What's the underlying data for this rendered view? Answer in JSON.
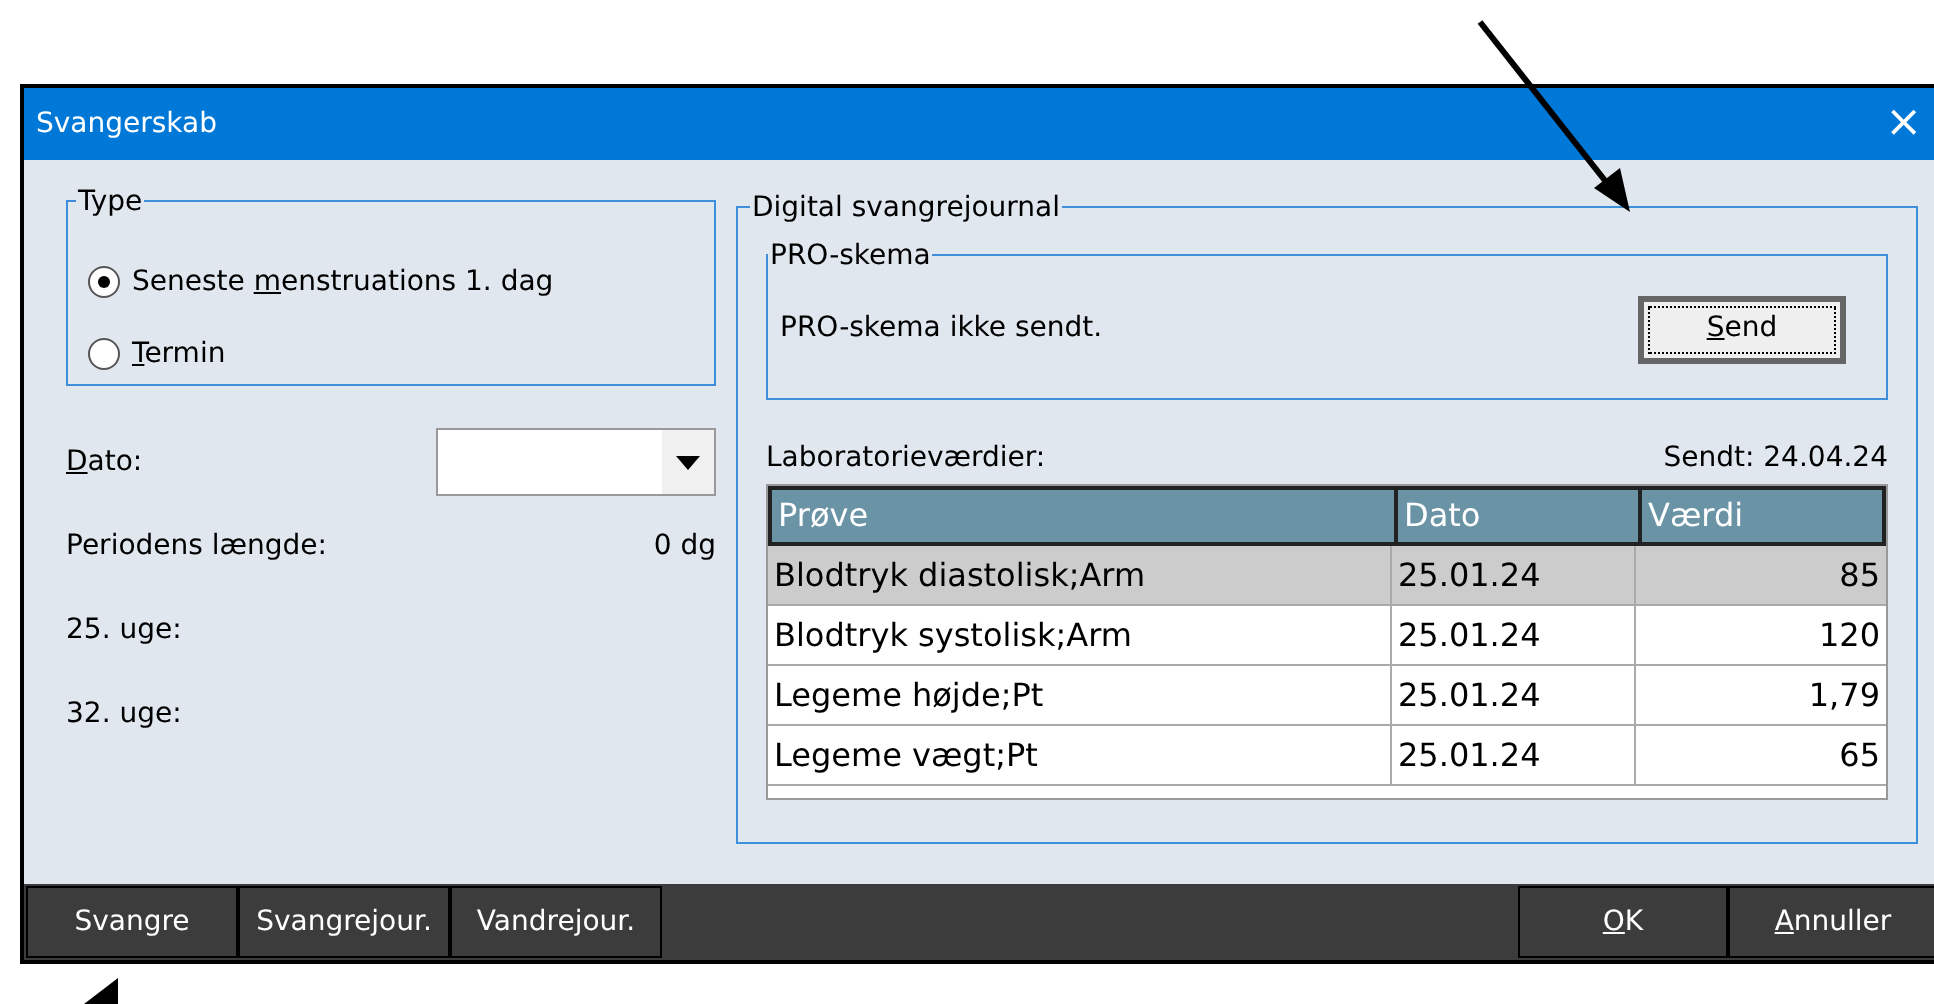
{
  "window": {
    "title": "Svangerskab",
    "close": "×"
  },
  "type_group": {
    "title": "Type",
    "options": [
      {
        "label": {
          "before": "Seneste ",
          "key": "m",
          "after": "enstruations 1. dag"
        },
        "selected": true
      },
      {
        "label": {
          "key": "T",
          "after": "ermin"
        },
        "selected": false
      }
    ]
  },
  "date": {
    "label": {
      "key": "D",
      "after": "ato:"
    }
  },
  "fields": [
    {
      "label": "Periodens længde:",
      "value": "0 dg"
    },
    {
      "label": "25. uge:"
    },
    {
      "label": "32. uge:"
    }
  ],
  "journal": {
    "title": "Digital svangrejournal",
    "pro": {
      "title": "PRO-skema",
      "status": "PRO-skema ikke sendt.",
      "button": {
        "key": "S",
        "after": "end"
      }
    },
    "lab_label": "Laboratorieværdier:",
    "sent": "Sendt: 24.04.24",
    "table": {
      "columns": [
        "Prøve",
        "Dato",
        "Værdi"
      ],
      "rows": [
        {
          "cells": [
            "Blodtryk diastolisk;Arm",
            "25.01.24",
            "85"
          ],
          "selected": true
        },
        {
          "cells": [
            "Blodtryk systolisk;Arm",
            "25.01.24",
            "120"
          ],
          "selected": false
        },
        {
          "cells": [
            "Legeme højde;Pt",
            "25.01.24",
            "1,79"
          ],
          "selected": false
        },
        {
          "cells": [
            "Legeme vægt;Pt",
            "25.01.24",
            "65"
          ],
          "selected": false
        }
      ]
    }
  },
  "bottom_tabs": [
    "Svangre",
    "Svangrejour.",
    "Vandrejour."
  ],
  "buttons": [
    {
      "key": "O",
      "after": "K"
    },
    {
      "key": "A",
      "after": "nnuller"
    }
  ]
}
